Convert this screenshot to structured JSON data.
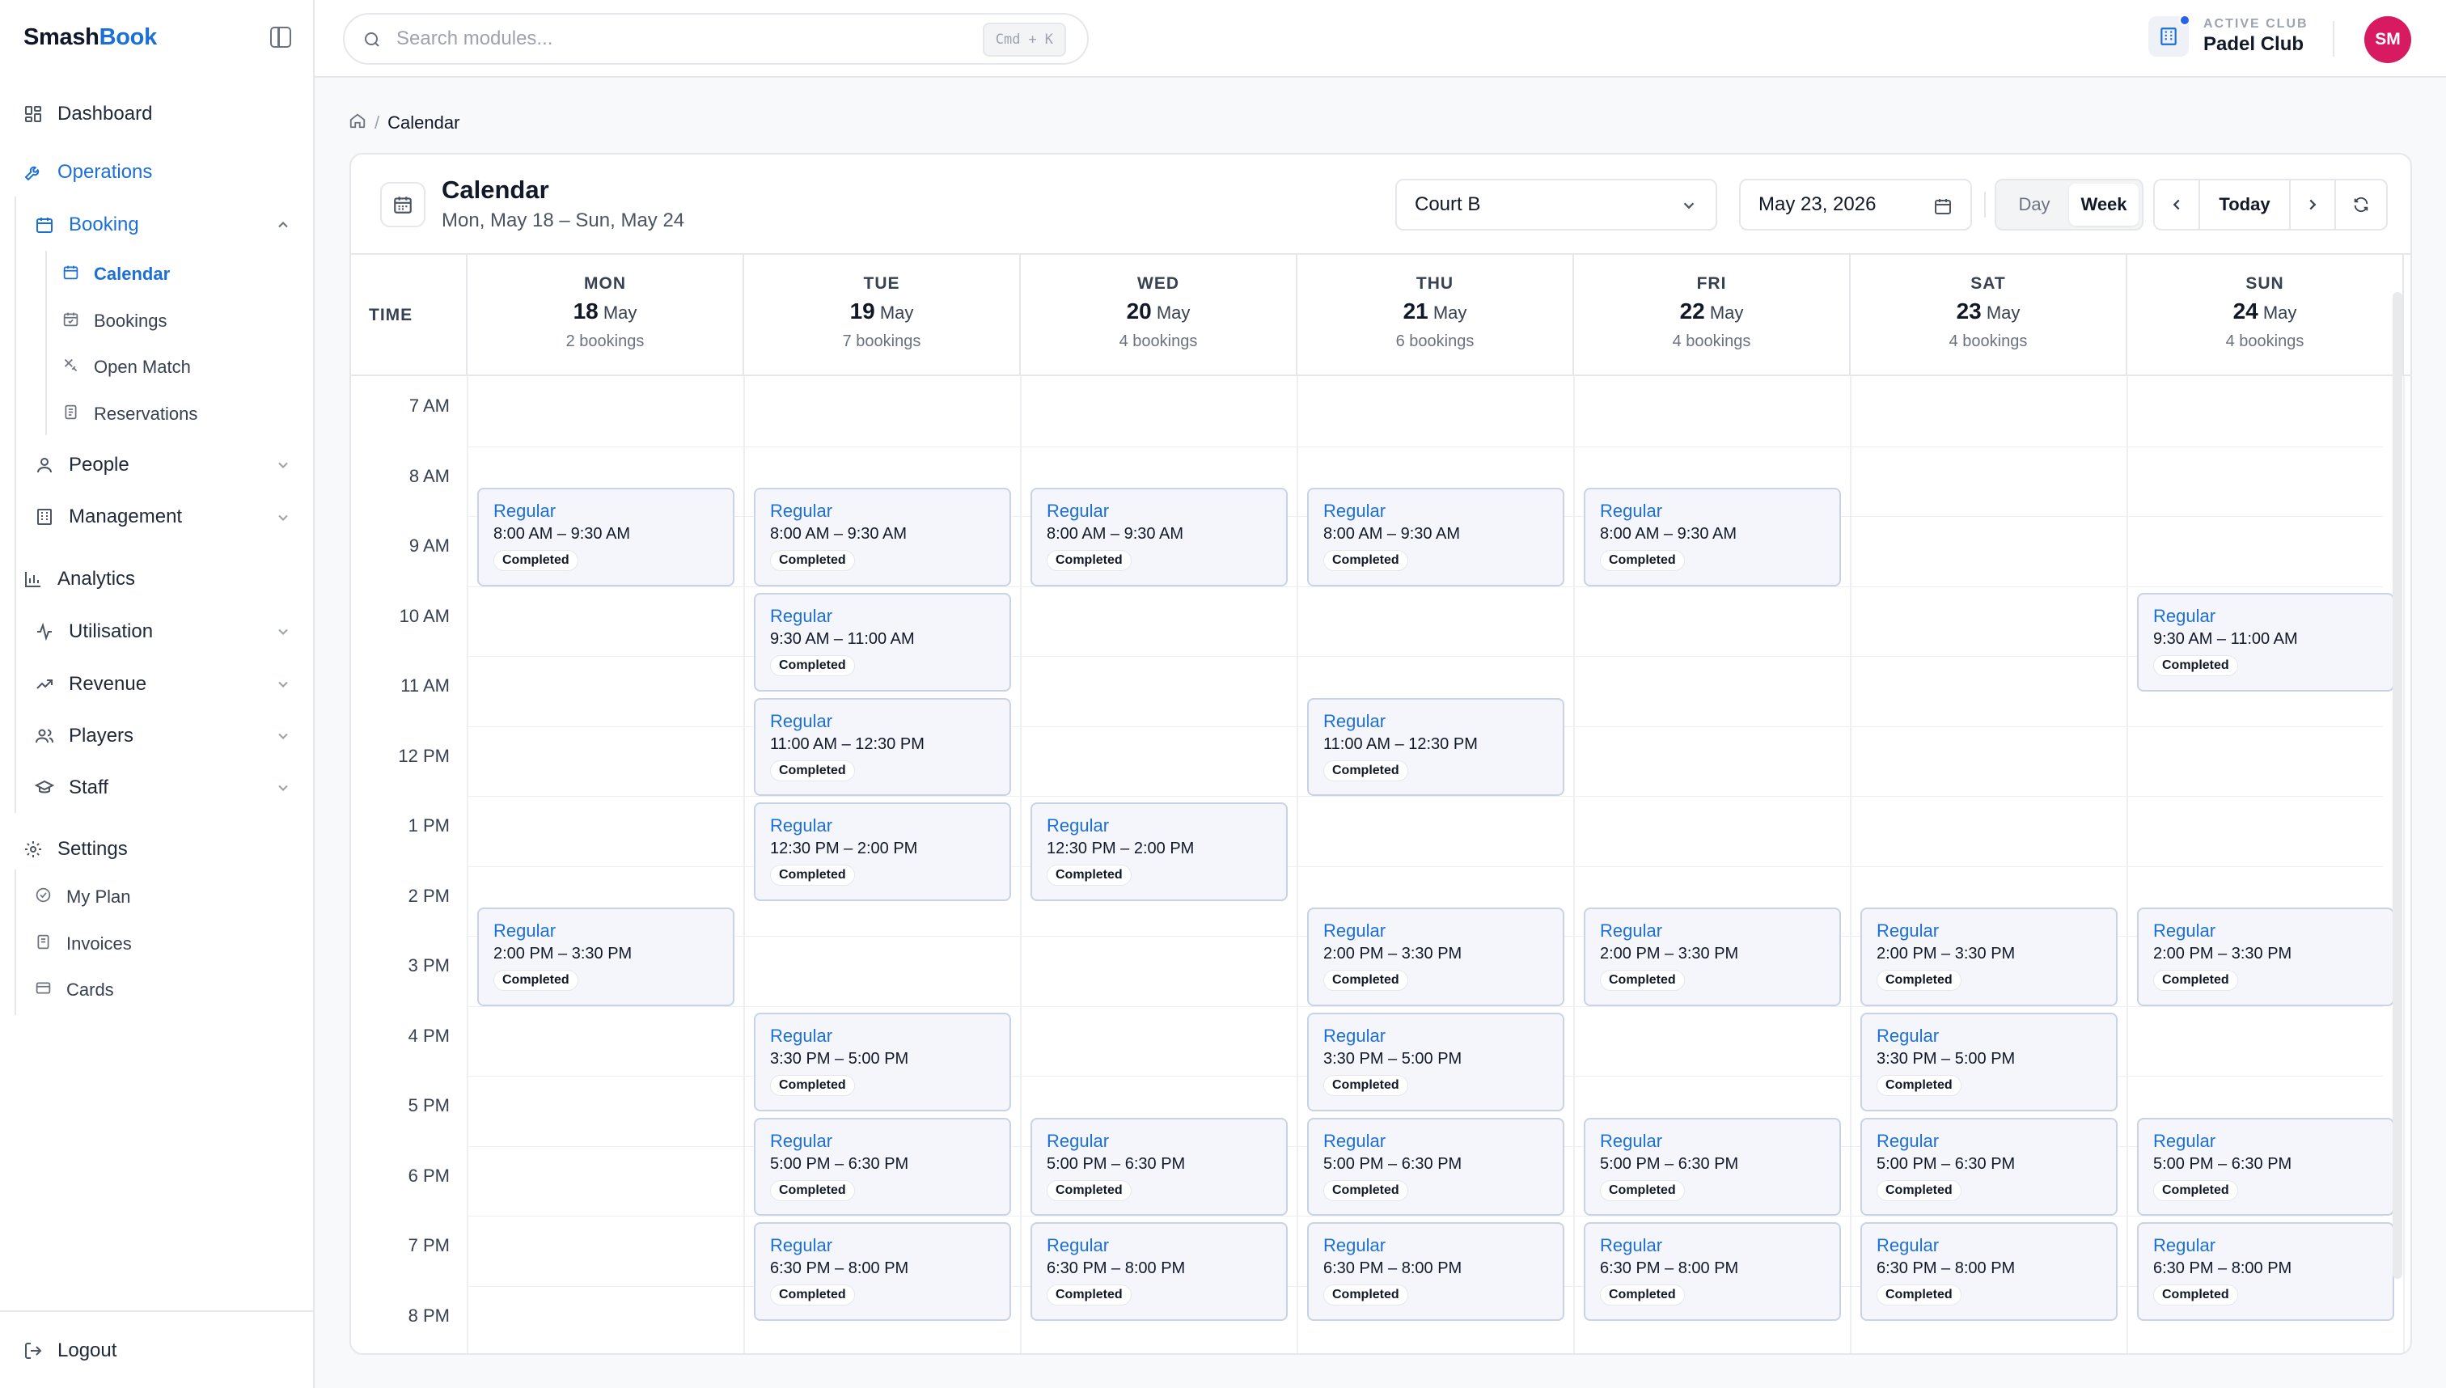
{
  "brand": {
    "part1": "Smash",
    "part2": "Book"
  },
  "sidebar": {
    "dashboard": "Dashboard",
    "operations": "Operations",
    "booking": "Booking",
    "calendar": "Calendar",
    "bookings": "Bookings",
    "open_match": "Open Match",
    "reservations": "Reservations",
    "people": "People",
    "management": "Management",
    "analytics": "Analytics",
    "utilisation": "Utilisation",
    "revenue": "Revenue",
    "players": "Players",
    "staff": "Staff",
    "settings": "Settings",
    "my_plan": "My Plan",
    "invoices": "Invoices",
    "cards": "Cards",
    "logout": "Logout"
  },
  "topbar": {
    "search_placeholder": "Search modules...",
    "shortcut_key1": "Cmd",
    "shortcut_plus": "+",
    "shortcut_key2": "K",
    "club_label": "ACTIVE CLUB",
    "club_name": "Padel Club",
    "avatar_initials": "SM"
  },
  "breadcrumb": {
    "current": "Calendar",
    "separator": "/"
  },
  "calendar": {
    "title": "Calendar",
    "range": "Mon, May 18 – Sun, May 24",
    "court": "Court B",
    "date": "May 23, 2026",
    "view_day": "Day",
    "view_week": "Week",
    "today": "Today",
    "time_header": "TIME",
    "days": [
      {
        "name": "MON",
        "num": "18",
        "month": "May",
        "count": "2 bookings"
      },
      {
        "name": "TUE",
        "num": "19",
        "month": "May",
        "count": "7 bookings"
      },
      {
        "name": "WED",
        "num": "20",
        "month": "May",
        "count": "4 bookings"
      },
      {
        "name": "THU",
        "num": "21",
        "month": "May",
        "count": "6 bookings"
      },
      {
        "name": "FRI",
        "num": "22",
        "month": "May",
        "count": "4 bookings"
      },
      {
        "name": "SAT",
        "num": "23",
        "month": "May",
        "count": "4 bookings"
      },
      {
        "name": "SUN",
        "num": "24",
        "month": "May",
        "count": "4 bookings"
      }
    ],
    "hours": [
      "7 AM",
      "8 AM",
      "9 AM",
      "10 AM",
      "11 AM",
      "12 PM",
      "1 PM",
      "2 PM",
      "3 PM",
      "4 PM",
      "5 PM",
      "6 PM",
      "7 PM",
      "8 PM"
    ],
    "bookings": [
      {
        "day": 0,
        "start": 8.0,
        "end": 9.5,
        "title": "Regular",
        "time": "8:00 AM – 9:30 AM",
        "status": "Completed"
      },
      {
        "day": 0,
        "start": 14.0,
        "end": 15.5,
        "title": "Regular",
        "time": "2:00 PM – 3:30 PM",
        "status": "Completed"
      },
      {
        "day": 1,
        "start": 8.0,
        "end": 9.5,
        "title": "Regular",
        "time": "8:00 AM – 9:30 AM",
        "status": "Completed"
      },
      {
        "day": 1,
        "start": 9.5,
        "end": 11.0,
        "title": "Regular",
        "time": "9:30 AM – 11:00 AM",
        "status": "Completed"
      },
      {
        "day": 1,
        "start": 11.0,
        "end": 12.5,
        "title": "Regular",
        "time": "11:00 AM – 12:30 PM",
        "status": "Completed"
      },
      {
        "day": 1,
        "start": 12.5,
        "end": 14.0,
        "title": "Regular",
        "time": "12:30 PM – 2:00 PM",
        "status": "Completed"
      },
      {
        "day": 1,
        "start": 15.5,
        "end": 17.0,
        "title": "Regular",
        "time": "3:30 PM – 5:00 PM",
        "status": "Completed"
      },
      {
        "day": 1,
        "start": 17.0,
        "end": 18.5,
        "title": "Regular",
        "time": "5:00 PM – 6:30 PM",
        "status": "Completed"
      },
      {
        "day": 1,
        "start": 18.5,
        "end": 20.0,
        "title": "Regular",
        "time": "6:30 PM – 8:00 PM",
        "status": "Completed"
      },
      {
        "day": 2,
        "start": 8.0,
        "end": 9.5,
        "title": "Regular",
        "time": "8:00 AM – 9:30 AM",
        "status": "Completed"
      },
      {
        "day": 2,
        "start": 12.5,
        "end": 14.0,
        "title": "Regular",
        "time": "12:30 PM – 2:00 PM",
        "status": "Completed"
      },
      {
        "day": 2,
        "start": 17.0,
        "end": 18.5,
        "title": "Regular",
        "time": "5:00 PM – 6:30 PM",
        "status": "Completed"
      },
      {
        "day": 2,
        "start": 18.5,
        "end": 20.0,
        "title": "Regular",
        "time": "6:30 PM – 8:00 PM",
        "status": "Completed"
      },
      {
        "day": 3,
        "start": 8.0,
        "end": 9.5,
        "title": "Regular",
        "time": "8:00 AM – 9:30 AM",
        "status": "Completed"
      },
      {
        "day": 3,
        "start": 11.0,
        "end": 12.5,
        "title": "Regular",
        "time": "11:00 AM – 12:30 PM",
        "status": "Completed"
      },
      {
        "day": 3,
        "start": 14.0,
        "end": 15.5,
        "title": "Regular",
        "time": "2:00 PM – 3:30 PM",
        "status": "Completed"
      },
      {
        "day": 3,
        "start": 15.5,
        "end": 17.0,
        "title": "Regular",
        "time": "3:30 PM – 5:00 PM",
        "status": "Completed"
      },
      {
        "day": 3,
        "start": 17.0,
        "end": 18.5,
        "title": "Regular",
        "time": "5:00 PM – 6:30 PM",
        "status": "Completed"
      },
      {
        "day": 3,
        "start": 18.5,
        "end": 20.0,
        "title": "Regular",
        "time": "6:30 PM – 8:00 PM",
        "status": "Completed"
      },
      {
        "day": 4,
        "start": 8.0,
        "end": 9.5,
        "title": "Regular",
        "time": "8:00 AM – 9:30 AM",
        "status": "Completed"
      },
      {
        "day": 4,
        "start": 14.0,
        "end": 15.5,
        "title": "Regular",
        "time": "2:00 PM – 3:30 PM",
        "status": "Completed"
      },
      {
        "day": 4,
        "start": 17.0,
        "end": 18.5,
        "title": "Regular",
        "time": "5:00 PM – 6:30 PM",
        "status": "Completed"
      },
      {
        "day": 4,
        "start": 18.5,
        "end": 20.0,
        "title": "Regular",
        "time": "6:30 PM – 8:00 PM",
        "status": "Completed"
      },
      {
        "day": 5,
        "start": 14.0,
        "end": 15.5,
        "title": "Regular",
        "time": "2:00 PM – 3:30 PM",
        "status": "Completed"
      },
      {
        "day": 5,
        "start": 15.5,
        "end": 17.0,
        "title": "Regular",
        "time": "3:30 PM – 5:00 PM",
        "status": "Completed"
      },
      {
        "day": 5,
        "start": 17.0,
        "end": 18.5,
        "title": "Regular",
        "time": "5:00 PM – 6:30 PM",
        "status": "Completed"
      },
      {
        "day": 5,
        "start": 18.5,
        "end": 20.0,
        "title": "Regular",
        "time": "6:30 PM – 8:00 PM",
        "status": "Completed"
      },
      {
        "day": 6,
        "start": 9.5,
        "end": 11.0,
        "title": "Regular",
        "time": "9:30 AM – 11:00 AM",
        "status": "Completed"
      },
      {
        "day": 6,
        "start": 14.0,
        "end": 15.5,
        "title": "Regular",
        "time": "2:00 PM – 3:30 PM",
        "status": "Completed"
      },
      {
        "day": 6,
        "start": 17.0,
        "end": 18.5,
        "title": "Regular",
        "time": "5:00 PM – 6:30 PM",
        "status": "Completed"
      },
      {
        "day": 6,
        "start": 18.5,
        "end": 20.0,
        "title": "Regular",
        "time": "6:30 PM – 8:00 PM",
        "status": "Completed"
      }
    ]
  },
  "colors": {
    "accent": "#1d6fd8",
    "avatar": "#d81b60",
    "booking_bg": "#f4f6fb",
    "booking_border": "#c9d3e5"
  }
}
